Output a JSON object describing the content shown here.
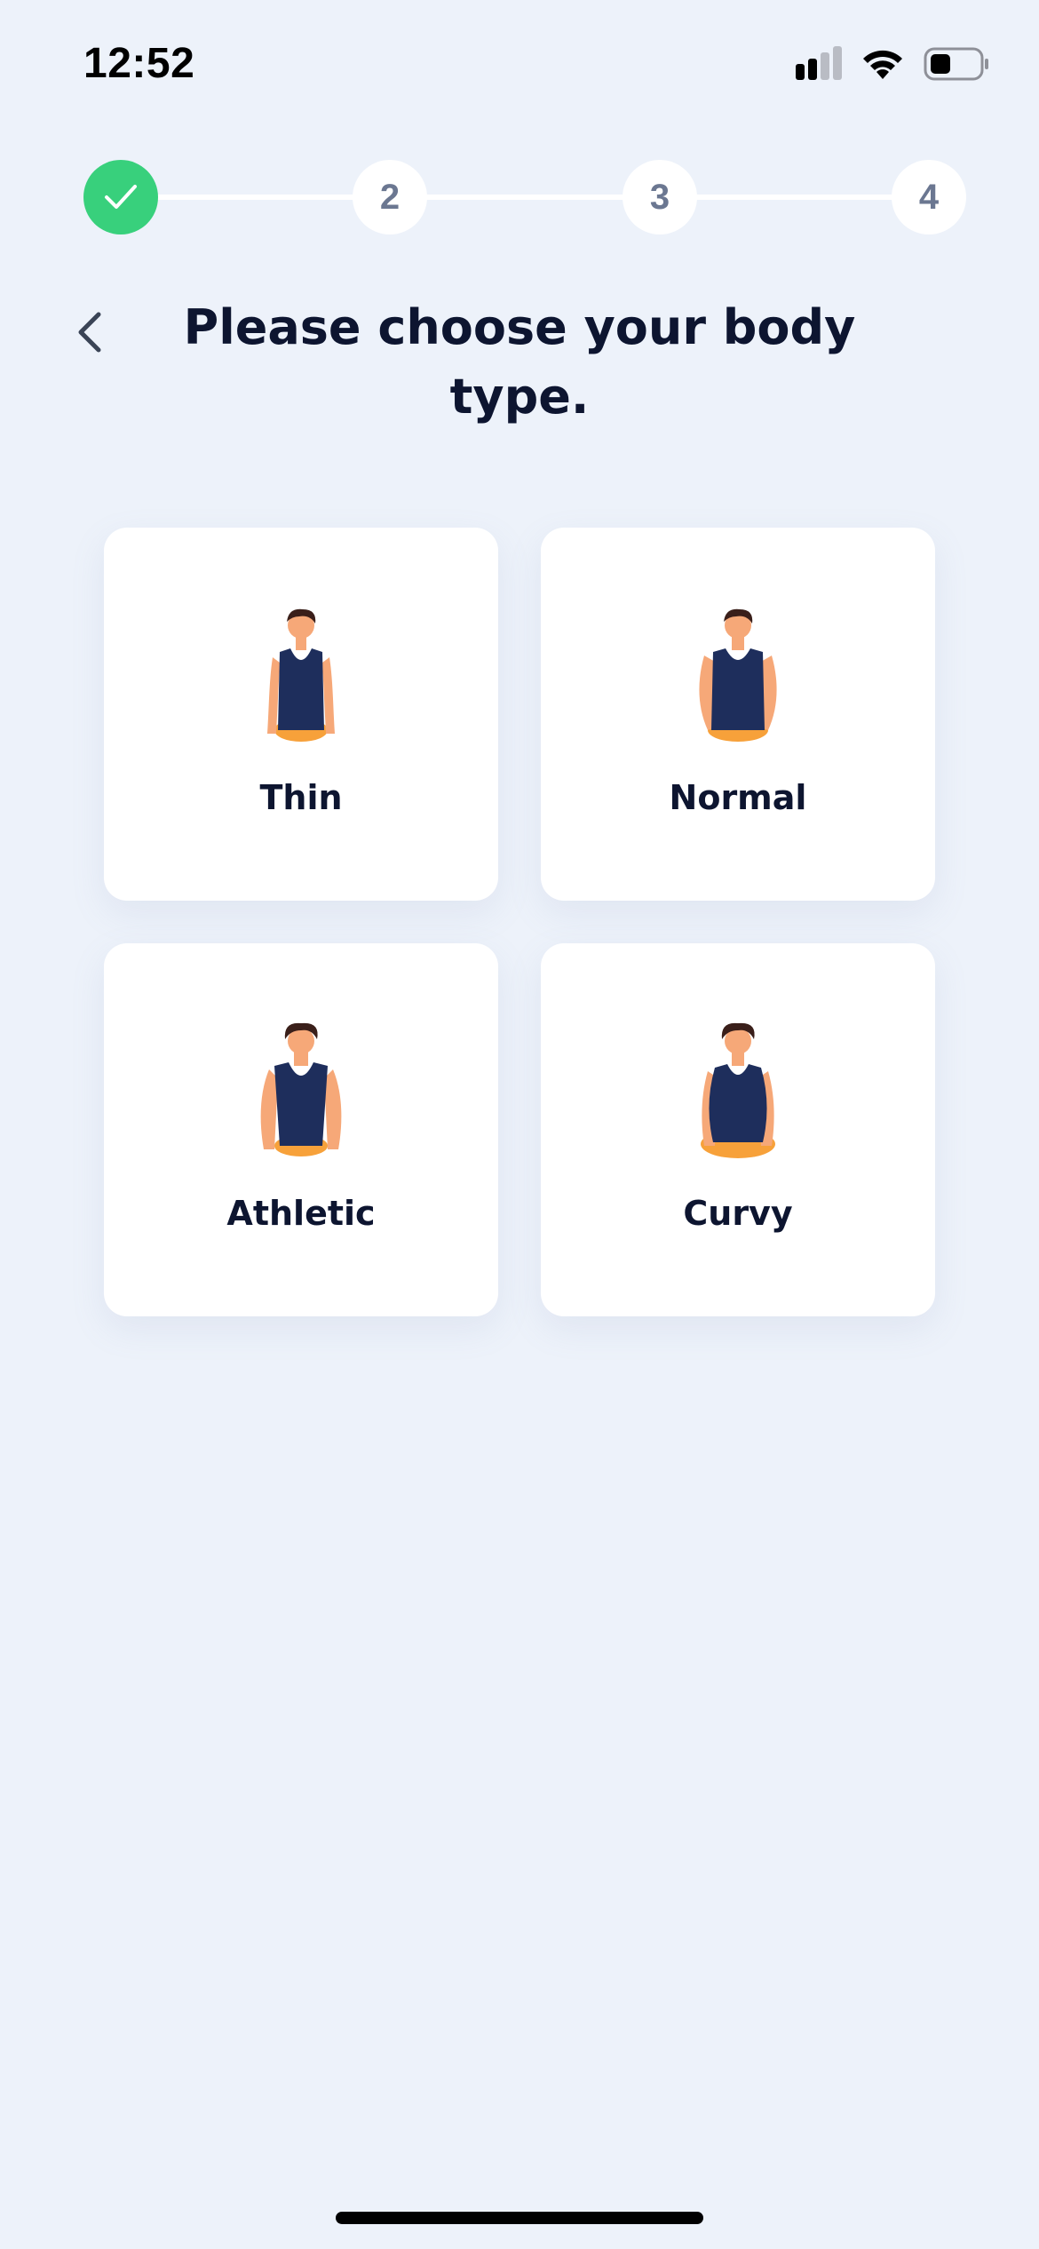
{
  "status_bar": {
    "time": "12:52",
    "icons": [
      "cellular-signal-icon",
      "wifi-icon",
      "battery-icon"
    ]
  },
  "stepper": {
    "steps": [
      {
        "label": "",
        "state": "completed",
        "icon": "check-icon"
      },
      {
        "label": "2",
        "state": "upcoming"
      },
      {
        "label": "3",
        "state": "upcoming"
      },
      {
        "label": "4",
        "state": "upcoming"
      }
    ],
    "completed_color": "#38d07c"
  },
  "header": {
    "back_icon": "chevron-left-icon",
    "title": "Please choose your body type."
  },
  "body_types": [
    {
      "label": "Thin",
      "icon": "thin-body-figure"
    },
    {
      "label": "Normal",
      "icon": "normal-body-figure"
    },
    {
      "label": "Athletic",
      "icon": "athletic-body-figure"
    },
    {
      "label": "Curvy",
      "icon": "curvy-body-figure"
    }
  ],
  "colors": {
    "background": "#edf2fa",
    "card": "#ffffff",
    "text": "#0d1530",
    "figure_shirt": "#1e2e5c",
    "figure_skin": "#f6a878",
    "figure_shorts": "#f7a13a",
    "figure_hair": "#3a1f1a"
  }
}
